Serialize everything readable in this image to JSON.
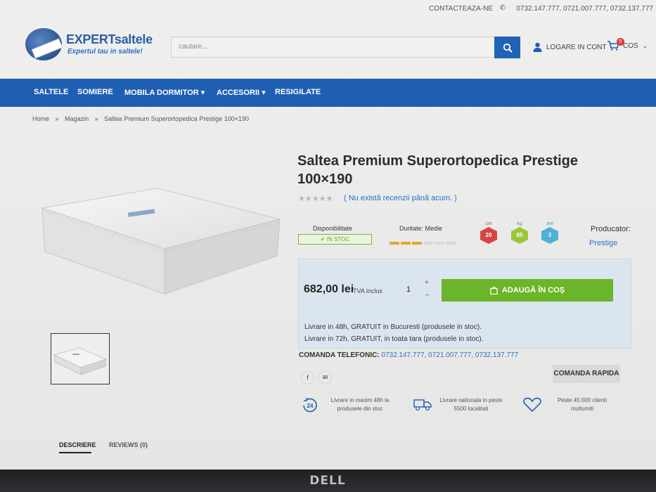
{
  "topbar": {
    "contact_label": "CONTACTEAZA-NE",
    "phones": "0732.147.777, 0721.007.777, 0732.137.777"
  },
  "header": {
    "logo_name": "EXPERTsaltele",
    "logo_tagline": "Expertul tau in saltele!",
    "search_placeholder": "cautare...",
    "login_label": "LOGARE IN CONT",
    "cart_label": "COS",
    "cart_count": "0"
  },
  "nav": {
    "items": [
      {
        "label": "SALTELE"
      },
      {
        "label": "SOMIERE"
      },
      {
        "label": "MOBILA DORMITOR ▾"
      },
      {
        "label": "ACCESORII ▾"
      },
      {
        "label": "RESIGILATE"
      }
    ]
  },
  "breadcrumb": {
    "items": [
      "Home",
      "»",
      "Magazin",
      "»",
      "Saltea Premium Superortopedica Prestige 100×190"
    ]
  },
  "product": {
    "title": "Saltea Premium Superortopedica Prestige 100×190",
    "stars": "★★★★★",
    "reviews_link": "( Nu există recenzii până acum. )",
    "availability_label": "Disponibilitate",
    "availability_value": "✔ IN STOC",
    "durity_label": "Duritate: Medie",
    "durity_level": 0.5,
    "specs": [
      {
        "unit": "cm",
        "value": "20",
        "color": "#d64545"
      },
      {
        "unit": "kg",
        "value": "85",
        "color": "#9bc43a"
      },
      {
        "unit": "ani",
        "value": "3",
        "color": "#4fb0d8"
      }
    ],
    "producer_label": "Producator:",
    "producer_value": "Prestige",
    "price": "682,00 lei",
    "tva_label": "TVA inclus",
    "quantity": "1",
    "qty_plus": "+",
    "qty_minus": "−",
    "add_to_cart": "ADAUGĂ ÎN COȘ",
    "delivery_line1": "Livrare in 48h, GRATUIT in Bucuresti (produsele in stoc).",
    "delivery_line2": "Livrare in 72h, GRATUIT, in toata tara (produsele in stoc).",
    "order_phone_label": "COMANDA TELEFONIC:",
    "order_phone_numbers": "0732.147.777, 0721.007.777, 0732.137.777",
    "quick_order": "COMANDA RAPIDA",
    "share_facebook": "f",
    "share_email": "✉"
  },
  "features": [
    {
      "icon": "24h-icon",
      "badge": "24",
      "text": "Livrare in maxim 48h la produsele din stoc"
    },
    {
      "icon": "truck-icon",
      "text": "Livrare nationala in peste 5500 localitati"
    },
    {
      "icon": "heart-icon",
      "text": "Peste 45 000 clienti multumiti"
    }
  ],
  "tabs": {
    "description": "DESCRIERE",
    "reviews": "REVIEWS (0)"
  },
  "monitor_brand": "DELL",
  "colors": {
    "brand_blue": "#1f5fb3",
    "add_to_cart_green": "#6ab528",
    "link_blue": "#2b6fc8"
  }
}
